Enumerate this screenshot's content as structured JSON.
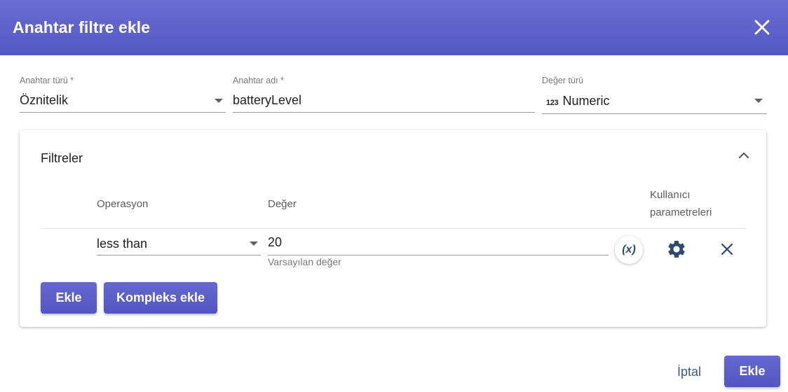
{
  "dialog": {
    "title": "Anahtar filtre ekle",
    "colors": {
      "header": "#5a5ec8",
      "primary_button": "#5a5ec8",
      "icon": "#2f4a6e"
    }
  },
  "key_type": {
    "label": "Anahtar türü *",
    "value": "Öznitelik"
  },
  "key_name": {
    "label": "Anahtar adı *",
    "value": "batteryLevel"
  },
  "value_type": {
    "label": "Değer türü",
    "icon_text": "123",
    "value": "Numeric"
  },
  "filters": {
    "title": "Filtreler",
    "columns": {
      "operation": "Operasyon",
      "value": "Değer",
      "user_params_line1": "Kullanıcı",
      "user_params_line2": "parametreleri"
    },
    "rows": [
      {
        "operation": "less than",
        "value": "20",
        "value_hint": "Varsayılan değer",
        "variable_symbol": "(x)"
      }
    ],
    "add_button": "Ekle",
    "add_complex_button": "Kompleks ekle"
  },
  "footer": {
    "cancel": "İptal",
    "submit": "Ekle"
  }
}
